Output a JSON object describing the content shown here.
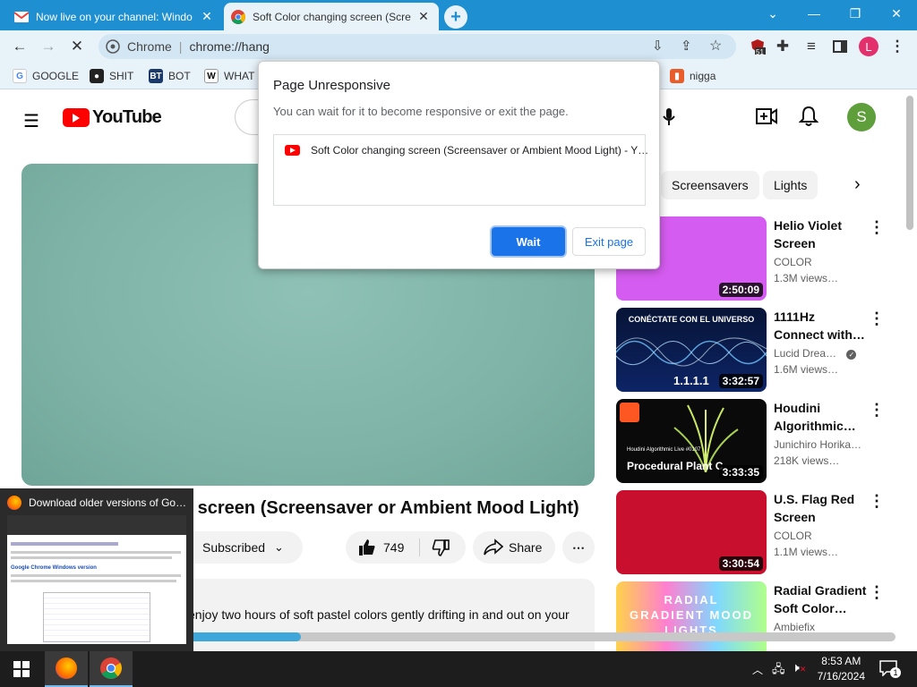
{
  "tabs": [
    {
      "title": "Now live on your channel: Windo",
      "icon": "gmail-icon"
    },
    {
      "title": "Soft Color changing screen (Scre",
      "icon": "chrome-icon"
    }
  ],
  "toolbar": {
    "site_label": "Chrome",
    "url": "chrome://hang",
    "extension_badge": "51",
    "profile_initial": "L"
  },
  "bookmarks": [
    {
      "label": "GOOGLE"
    },
    {
      "label": "SHIT"
    },
    {
      "label": "BOT"
    },
    {
      "label": "WHAT"
    },
    {
      "label": "nigga"
    }
  ],
  "youtube": {
    "logo_text": "YouTube",
    "avatar_initial": "S",
    "chips": [
      "Screensavers",
      "Lights"
    ],
    "video_title": "Soft Color changing screen (Screensaver or Ambient Mood Light)",
    "subscribed_label": "Subscribed",
    "like_count": "749",
    "share_label": "Share",
    "description": "enjoy two hours of soft pastel colors gently drifting in and out on your",
    "progress": 0.32
  },
  "recommendations": [
    {
      "title_line1": "Helio Violet",
      "title_line2": "Screen",
      "channel": "COLOR",
      "views": "1.3M views…",
      "duration": "2:50:09",
      "color": "#d55cf0"
    },
    {
      "title_line1": "1111Hz",
      "title_line2": "Connect with…",
      "channel": "Lucid Drea…",
      "views": "1.6M views…",
      "duration": "3:32:57",
      "thumb_text": "CONÉCTATE CON EL UNIVERSO",
      "thumb_num": "1.1.1.1",
      "color": "#0b1a4a"
    },
    {
      "title_line1": "Houdini",
      "title_line2": "Algorithmic…",
      "channel": "Junichiro Horika…",
      "views": "218K views…",
      "duration": "3:33:35",
      "thumb_text": "Procedural Plant C",
      "thumb_small": "Houdini Algorithmic Live #0107",
      "color": "#0a0a0a"
    },
    {
      "title_line1": "U.S. Flag Red",
      "title_line2": "Screen",
      "channel": "COLOR",
      "views": "1.1M views…",
      "duration": "3:30:54",
      "color": "#c8102e"
    },
    {
      "title_line1": "Radial Gradient",
      "title_line2": "Soft Color…",
      "channel": "Ambiefix",
      "views": "",
      "duration": "",
      "thumb_text": "RADIAL GRADIENT MOOD LIGHTS",
      "color": "#ff7fd0"
    }
  ],
  "dialog": {
    "title": "Page Unresponsive",
    "subtitle": "You can wait for it to become responsive or exit the page.",
    "page_item": "Soft Color changing screen (Screensaver or Ambient Mood Light) - Y…",
    "wait_label": "Wait",
    "exit_label": "Exit page"
  },
  "popup": {
    "title": "Download older versions of Go…",
    "doc_heading": "Google Chrome Windows version"
  },
  "taskbar": {
    "time": "8:53 AM",
    "date": "7/16/2024",
    "notification_count": "1"
  }
}
